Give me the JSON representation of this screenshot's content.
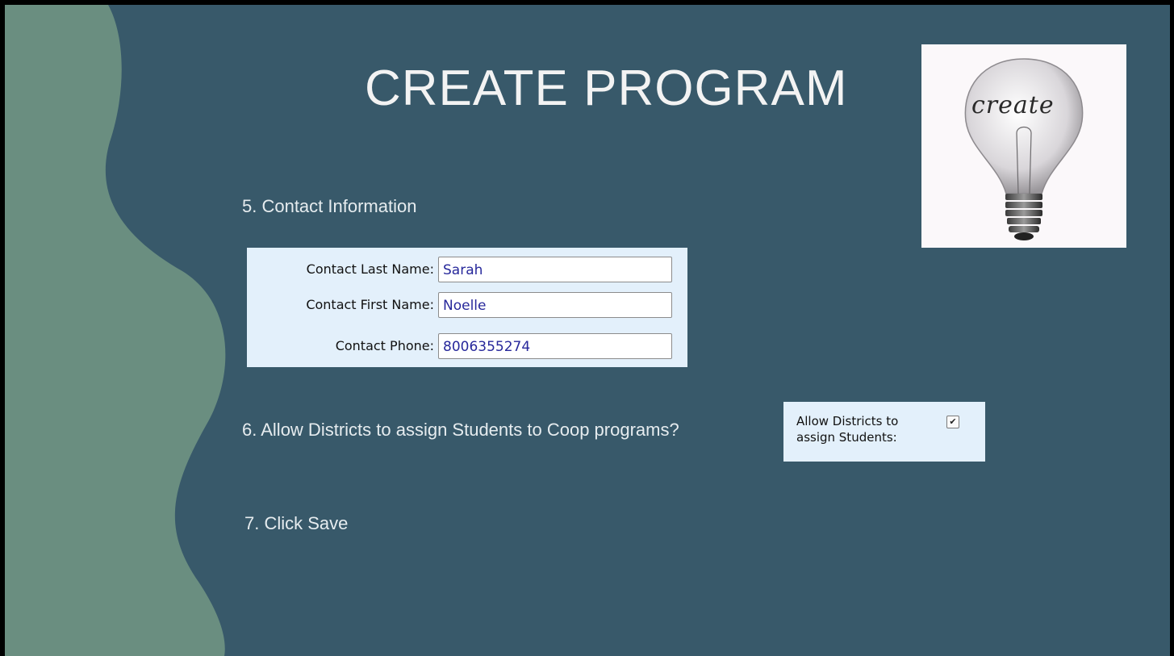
{
  "slide": {
    "title": "CREATE PROGRAM",
    "colors": {
      "background": "#38596a",
      "wave": "#6a8e80",
      "panel": "#e3f0fb",
      "field_text": "#27289b"
    }
  },
  "steps": {
    "contact": "5.  Contact Information",
    "allow": "6.  Allow Districts to assign Students to Coop programs?",
    "save": "7.   Click Save"
  },
  "contact_form": {
    "last_name": {
      "label": "Contact Last Name:",
      "value": "Sarah"
    },
    "first_name": {
      "label": "Contact First Name:",
      "value": "Noelle"
    },
    "phone": {
      "label": "Contact Phone:",
      "value": "8006355274"
    }
  },
  "allow_form": {
    "label_line1": "Allow Districts to",
    "label_line2": "assign Students:",
    "checked": true,
    "check_glyph": "✔"
  },
  "image": {
    "word": "create",
    "icon": "lightbulb-icon"
  }
}
